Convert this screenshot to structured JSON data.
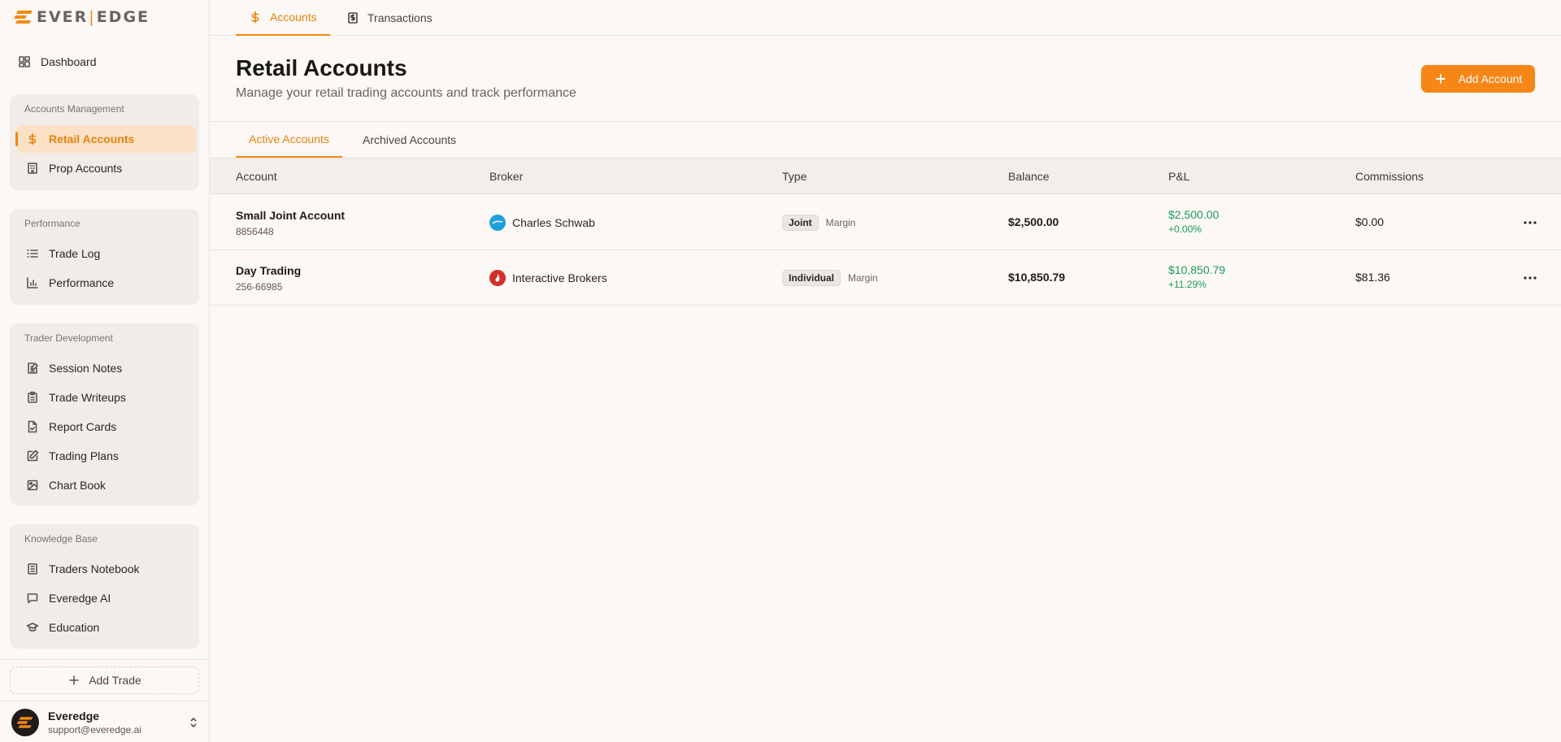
{
  "brand": {
    "logo_left": "EVER",
    "logo_right": "EDGE",
    "accent": "#f28a14"
  },
  "sidebar": {
    "dashboard": {
      "label": "Dashboard",
      "icon": "grid-icon"
    },
    "groups": [
      {
        "title": "Accounts Management",
        "items": [
          {
            "label": "Retail Accounts",
            "icon": "dollar-icon",
            "active": true
          },
          {
            "label": "Prop Accounts",
            "icon": "building-icon"
          }
        ]
      },
      {
        "title": "Performance",
        "items": [
          {
            "label": "Trade Log",
            "icon": "list-icon"
          },
          {
            "label": "Performance",
            "icon": "bar-chart-icon"
          }
        ]
      },
      {
        "title": "Trader Development",
        "items": [
          {
            "label": "Session Notes",
            "icon": "note-edit-icon"
          },
          {
            "label": "Trade Writeups",
            "icon": "clipboard-icon"
          },
          {
            "label": "Report Cards",
            "icon": "file-check-icon"
          },
          {
            "label": "Trading Plans",
            "icon": "pencil-square-icon"
          },
          {
            "label": "Chart Book",
            "icon": "image-icon"
          }
        ]
      },
      {
        "title": "Knowledge Base",
        "items": [
          {
            "label": "Traders Notebook",
            "icon": "notebook-icon"
          },
          {
            "label": "Everedge AI",
            "icon": "chat-icon"
          },
          {
            "label": "Education",
            "icon": "graduation-cap-icon"
          }
        ]
      }
    ],
    "add_trade": "Add Trade",
    "user": {
      "name": "Everedge",
      "email": "support@everedge.ai"
    }
  },
  "top_tabs": [
    {
      "label": "Accounts",
      "icon": "dollar-icon",
      "active": true
    },
    {
      "label": "Transactions",
      "icon": "receipt-icon"
    }
  ],
  "page": {
    "title": "Retail Accounts",
    "subtitle": "Manage your retail trading accounts and track performance",
    "add_button": "Add Account"
  },
  "sub_tabs": [
    {
      "label": "Active Accounts",
      "active": true
    },
    {
      "label": "Archived Accounts"
    }
  ],
  "table": {
    "headers": [
      "Account",
      "Broker",
      "Type",
      "Balance",
      "P&L",
      "Commissions"
    ],
    "rows": [
      {
        "name": "Small Joint Account",
        "number": "8856448",
        "broker": "Charles Schwab",
        "broker_color": "#1fa0dc",
        "type": "Joint",
        "type_sub": "Margin",
        "balance": "$2,500.00",
        "pnl": "$2,500.00",
        "pnl_pct": "+0.00%",
        "commissions": "$0.00"
      },
      {
        "name": "Day Trading",
        "number": "256-66985",
        "broker": "Interactive Brokers",
        "broker_color": "#d2302a",
        "type": "Individual",
        "type_sub": "Margin",
        "balance": "$10,850.79",
        "pnl": "$10,850.79",
        "pnl_pct": "+11.29%",
        "commissions": "$81.36"
      }
    ]
  }
}
